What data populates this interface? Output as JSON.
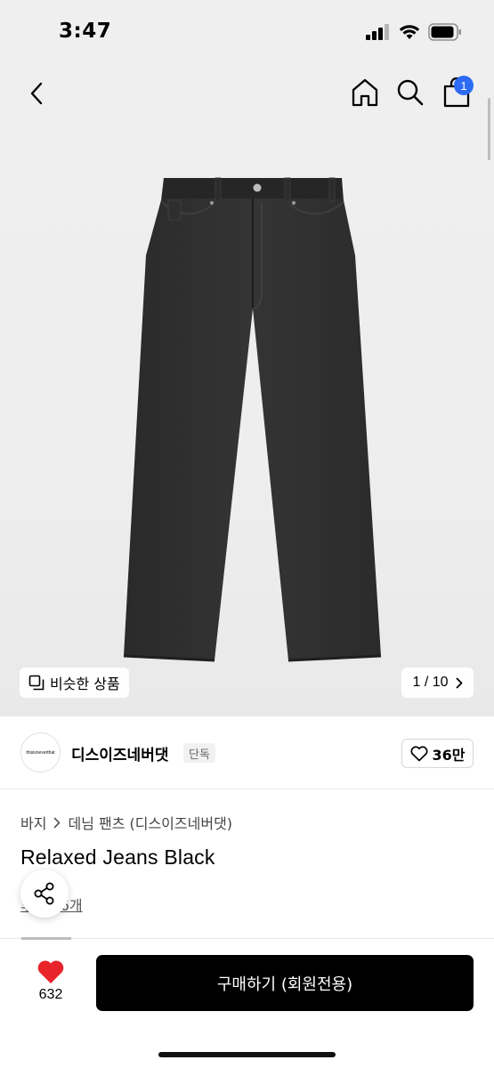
{
  "status_bar": {
    "time": "3:47"
  },
  "nav": {
    "cart_count": "1"
  },
  "gallery": {
    "similar_label": "비슷한 상품",
    "page_indicator": "1 / 10"
  },
  "brand": {
    "logo_text": "thisisneverthat",
    "name": "디스이즈네버댓",
    "exclusive_tag": "단독",
    "likes": "36만"
  },
  "breadcrumb": {
    "category": "바지",
    "subcategory": "데님 팬츠 (디스이즈네버댓)"
  },
  "product": {
    "title": "Relaxed Jeans Black",
    "review_text": "후기 26개"
  },
  "bottom_bar": {
    "wish_count": "632",
    "buy_label": "구매하기 (회원전용)"
  },
  "colors": {
    "badge": "#2d6bf4",
    "heart": "#e8232a",
    "buy_button": "#000000"
  }
}
